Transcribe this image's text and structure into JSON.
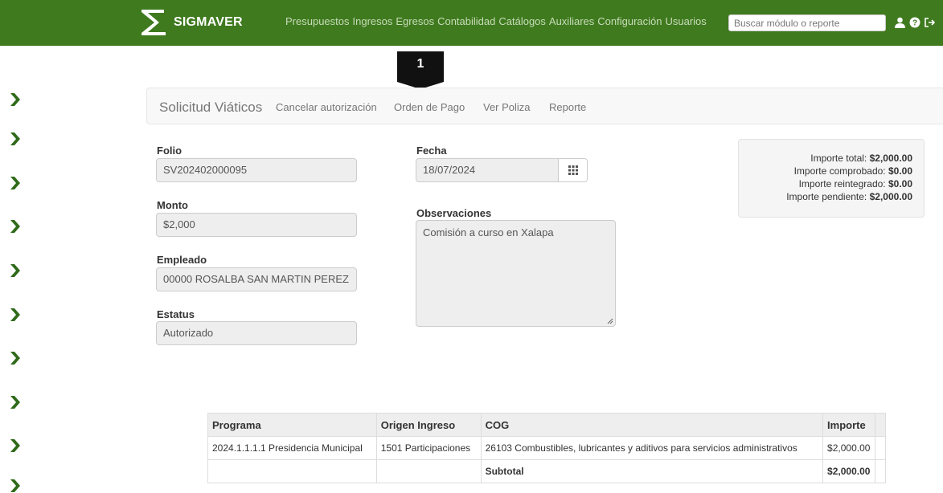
{
  "app": {
    "brand": "SIGMAVER"
  },
  "nav": {
    "menu": [
      "Presupuestos",
      "Ingresos",
      "Egresos",
      "Contabilidad",
      "Catálogos",
      "Auxiliares",
      "Configuración",
      "Usuarios"
    ],
    "search_placeholder": "Buscar módulo o reporte",
    "icons": [
      "user-icon",
      "help-icon",
      "logout-icon"
    ]
  },
  "step_badge": "1",
  "subnav": {
    "title": "Solicitud Viáticos",
    "links": [
      "Cancelar autorización",
      "Orden de Pago",
      "Ver Poliza",
      "Reporte"
    ]
  },
  "form": {
    "folio_label": "Folio",
    "folio_value": "SV202402000095",
    "monto_label": "Monto",
    "monto_value": "$2,000",
    "empleado_label": "Empleado",
    "empleado_value": "00000 ROSALBA SAN MARTIN PEREZ",
    "estatus_label": "Estatus",
    "estatus_value": "Autorizado",
    "fecha_label": "Fecha",
    "fecha_value": "18/07/2024",
    "observaciones_label": "Observaciones",
    "observaciones_value": "Comisión a curso en Xalapa"
  },
  "summary": {
    "total_label": "Importe total:",
    "total_value": "$2,000.00",
    "comprobado_label": "Importe comprobado:",
    "comprobado_value": "$0.00",
    "reintegrado_label": "Importe reintegrado:",
    "reintegrado_value": "$0.00",
    "pendiente_label": "Importe pendiente:",
    "pendiente_value": "$2,000.00"
  },
  "table": {
    "headers": [
      "Programa",
      "Origen Ingreso",
      "COG",
      "Importe"
    ],
    "rows": [
      [
        "2024.1.1.1.1 Presidencia Municipal",
        "1501 Participaciones",
        "26103 Combustibles, lubricantes y aditivos para servicios administrativos",
        "$2,000.00"
      ]
    ],
    "subtotal_label": "Subtotal",
    "subtotal_value": "$2,000.00"
  },
  "colors": {
    "navbar": "#3f7a1f",
    "chevron": "#2f6a1a",
    "badge": "#111111"
  }
}
